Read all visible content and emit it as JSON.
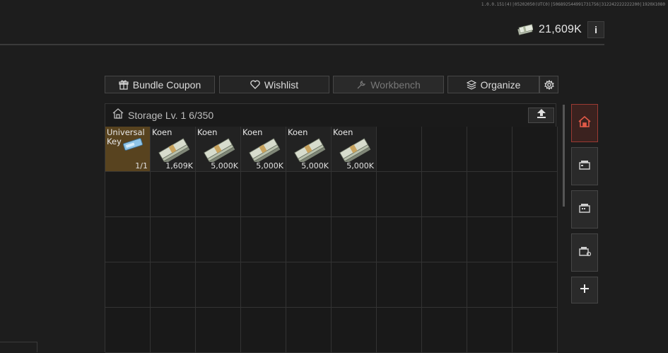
{
  "build_info": "1.0.0.151(4)|05202050(UTC0)|506892544991731756|312242222222200|1920X1080",
  "currency": {
    "icon": "koen-money-icon",
    "balance": "21,609K"
  },
  "toolbar": {
    "bundle_coupon": "Bundle Coupon",
    "wishlist": "Wishlist",
    "workbench": "Workbench",
    "organize": "Organize"
  },
  "storage": {
    "title": "Storage Lv. 1 6/350",
    "items": [
      {
        "name": "Universal Key",
        "amount": "1/1",
        "type": "key"
      },
      {
        "name": "Koen",
        "amount": "1,609K",
        "type": "money"
      },
      {
        "name": "Koen",
        "amount": "5,000K",
        "type": "money"
      },
      {
        "name": "Koen",
        "amount": "5,000K",
        "type": "money"
      },
      {
        "name": "Koen",
        "amount": "5,000K",
        "type": "money"
      },
      {
        "name": "Koen",
        "amount": "5,000K",
        "type": "money"
      }
    ]
  },
  "sidebar": {
    "tabs": [
      {
        "icon": "storage-home-icon",
        "active": true
      },
      {
        "icon": "storage-box-1-icon",
        "active": false
      },
      {
        "icon": "storage-box-2-icon",
        "active": false
      },
      {
        "icon": "storage-box-3-icon",
        "active": false
      }
    ],
    "add_icon": "plus-icon"
  },
  "colors": {
    "accent": "#9b3a33",
    "key_bg": "#58431f",
    "background": "#1d1d1d"
  }
}
